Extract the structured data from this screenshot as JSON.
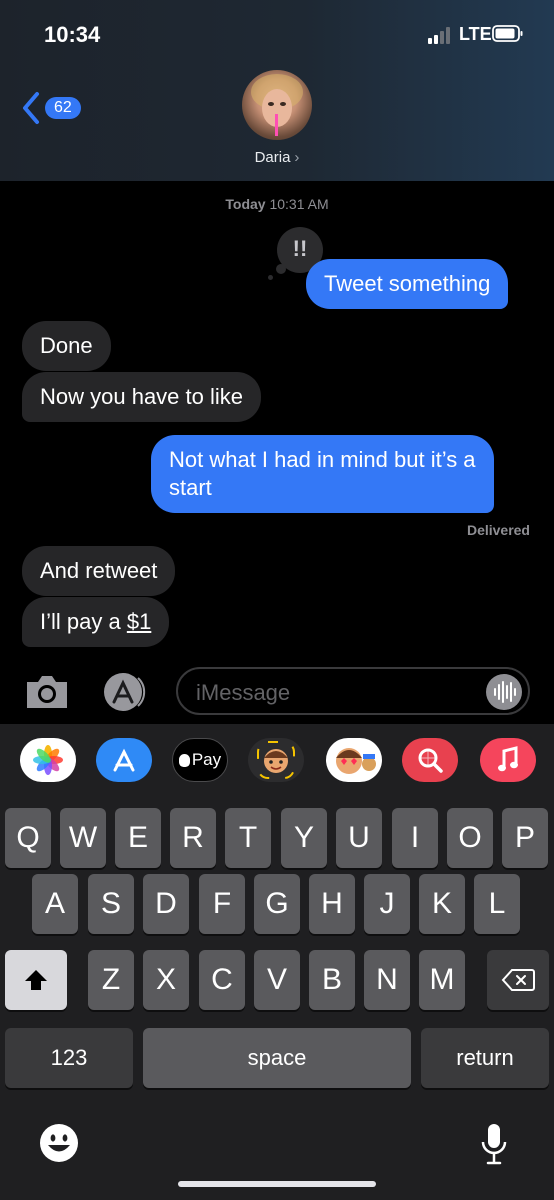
{
  "status_bar": {
    "time": "10:34",
    "network": "LTE"
  },
  "header": {
    "unread_count": "62",
    "contact_name": "Daria"
  },
  "conversation": {
    "timestamp_day": "Today",
    "timestamp_time": "10:31 AM",
    "tapback": "!!",
    "messages": [
      {
        "from": "me",
        "text": "Tweet something"
      },
      {
        "from": "them",
        "text": "Done"
      },
      {
        "from": "them",
        "text": "Now you have to like"
      },
      {
        "from": "me",
        "text_line1": "Not what I had in mind but it’s a",
        "text_line2": "start"
      },
      {
        "from": "them",
        "text": "And retweet"
      },
      {
        "from": "them",
        "text_prefix": "I’ll pay a ",
        "text_money": "$1"
      }
    ],
    "delivered_label": "Delivered"
  },
  "composer": {
    "placeholder": "iMessage"
  },
  "app_strip": {
    "items": [
      "photos-icon",
      "app-store-icon",
      "apple-pay-icon",
      "memoji-icon",
      "memoji-stickers-icon",
      "images-search-icon",
      "music-icon"
    ],
    "apple_pay_label": "Pay"
  },
  "keyboard": {
    "row1": [
      "Q",
      "W",
      "E",
      "R",
      "T",
      "Y",
      "U",
      "I",
      "O",
      "P"
    ],
    "row2": [
      "A",
      "S",
      "D",
      "F",
      "G",
      "H",
      "J",
      "K",
      "L"
    ],
    "row3": [
      "Z",
      "X",
      "C",
      "V",
      "B",
      "N",
      "M"
    ],
    "numbers_label": "123",
    "space_label": "space",
    "return_label": "return"
  },
  "colors": {
    "imessage_blue": "#3478f6",
    "received_gray": "#262628",
    "keyboard_bg": "#1f1f21",
    "key_bg": "#5a5a5d"
  }
}
